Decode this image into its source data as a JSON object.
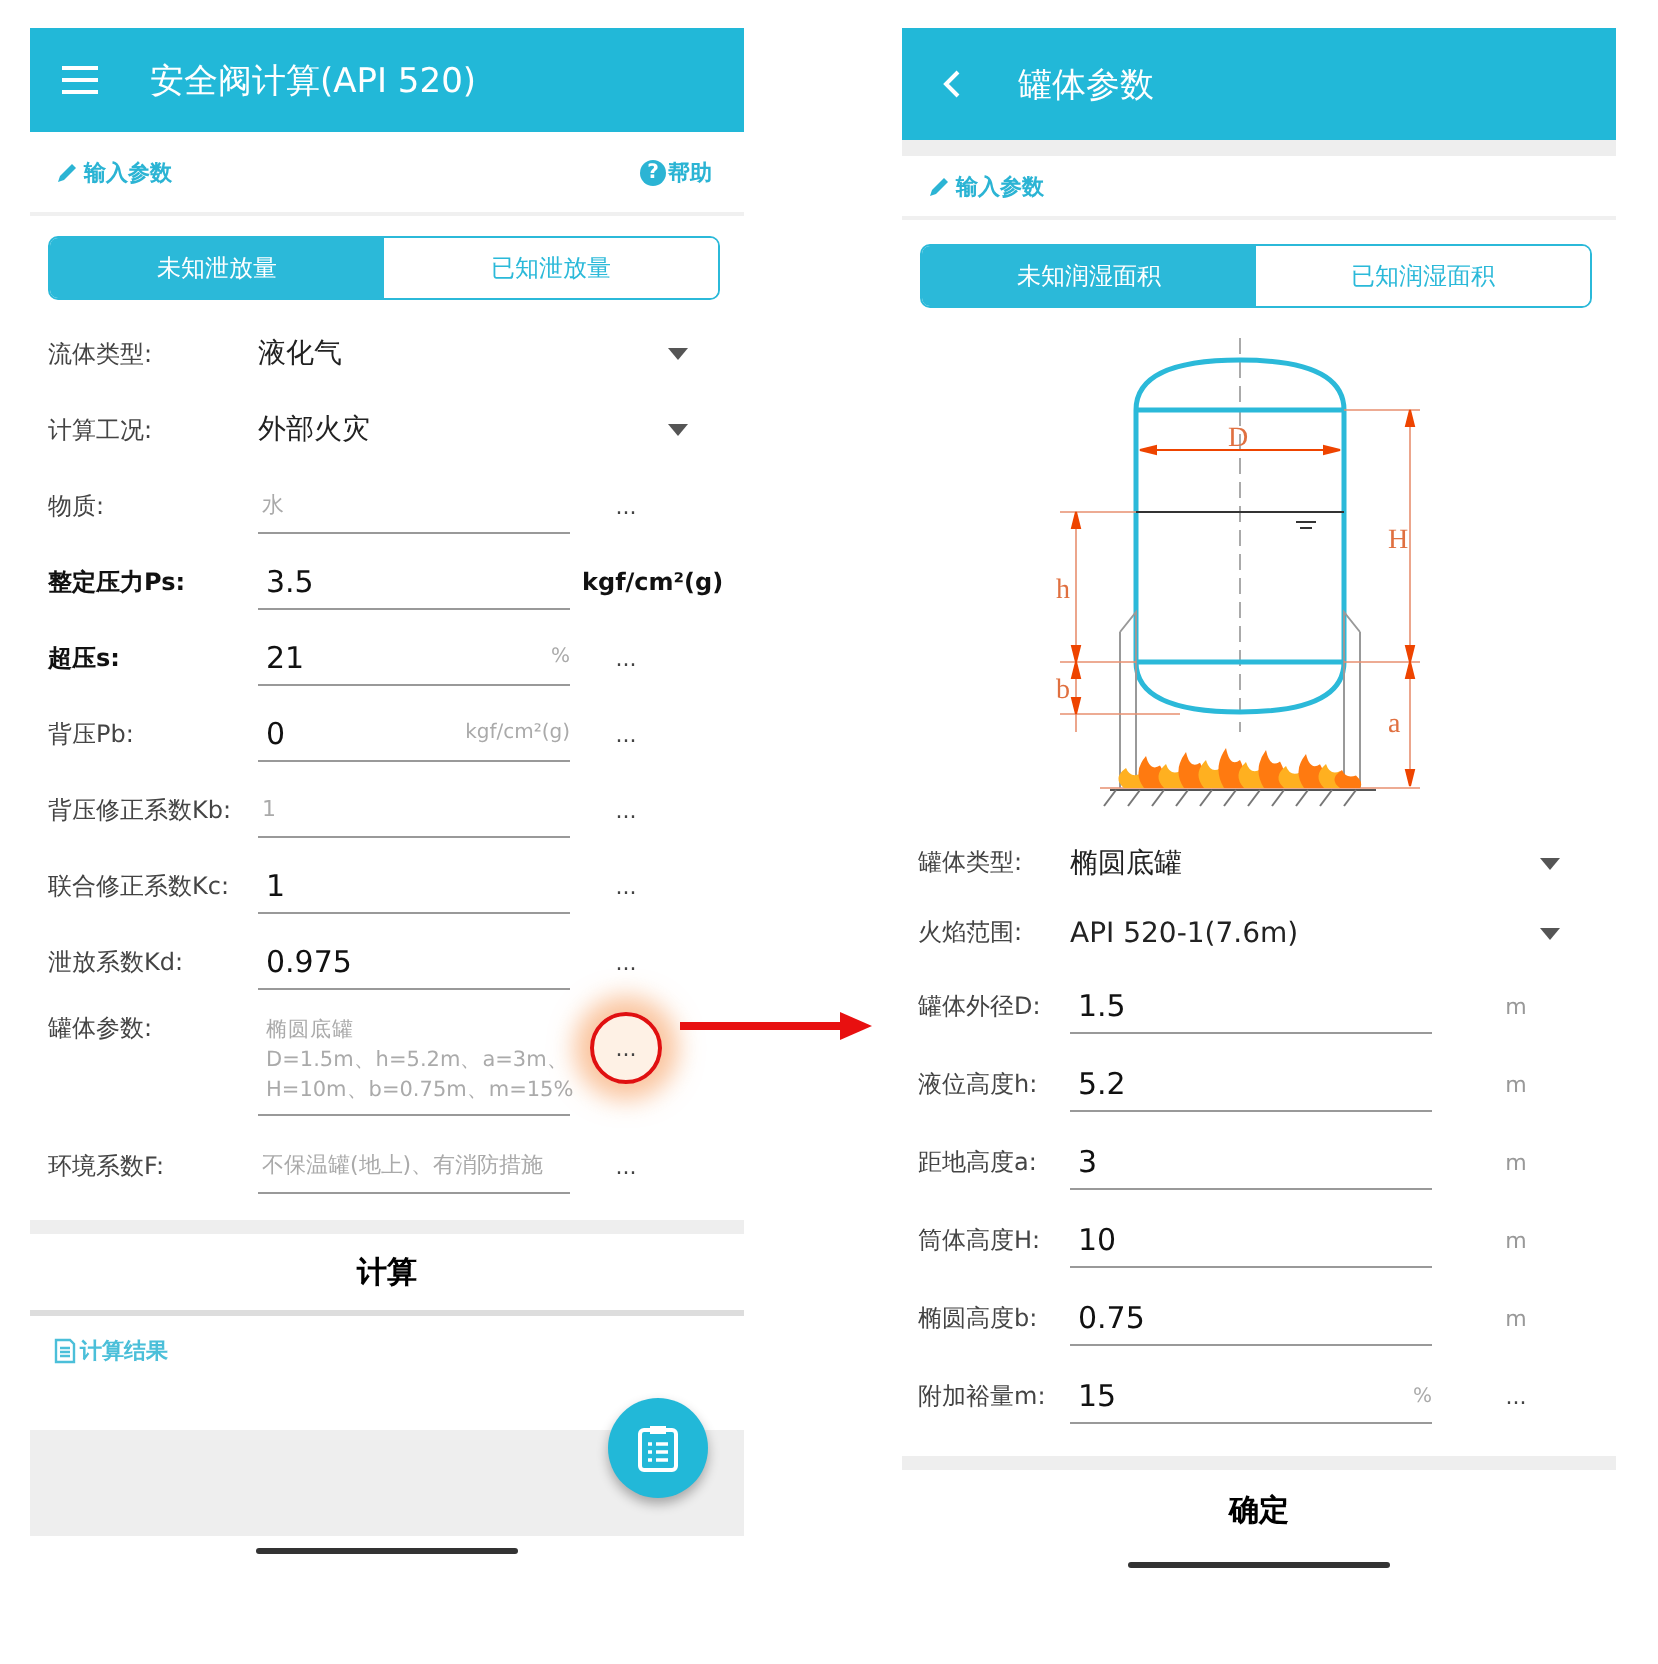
{
  "left": {
    "header": {
      "title": "安全阀计算(API 520)"
    },
    "section": {
      "title": "输入参数",
      "help_icon": "?",
      "help": "帮助"
    },
    "tabs": [
      {
        "label": "未知泄放量",
        "selected": true
      },
      {
        "label": "已知泄放量",
        "selected": false
      }
    ],
    "rows": [
      {
        "kind": "select",
        "label": "流体类型:",
        "value": "液化气",
        "emphasized": false
      },
      {
        "kind": "select",
        "label": "计算工况:",
        "value": "外部火灾",
        "emphasized": false
      },
      {
        "kind": "input",
        "label": "物质:",
        "placeholder": "水",
        "more": "...",
        "highlighted": false,
        "emphasized": false
      },
      {
        "kind": "input",
        "label": "整定压力Ps:",
        "value": "3.5",
        "unit": "kgf/cm²(g)",
        "emphasized": true
      },
      {
        "kind": "input",
        "label": "超压s:",
        "value": "21",
        "suffix": "%",
        "more": "...",
        "highlighted": false,
        "emphasized": true
      },
      {
        "kind": "input",
        "label": "背压Pb:",
        "value": "0",
        "suffix": "kgf/cm²(g)",
        "more": "...",
        "highlighted": false,
        "emphasized": false
      },
      {
        "kind": "input",
        "label": "背压修正系数Kb:",
        "placeholder": "1",
        "more": "...",
        "highlighted": false,
        "emphasized": false
      },
      {
        "kind": "input",
        "label": "联合修正系数Kc:",
        "value": "1",
        "more": "...",
        "highlighted": false,
        "emphasized": false
      },
      {
        "kind": "input",
        "label": "泄放系数Kd:",
        "value": "0.975",
        "more": "...",
        "highlighted": false,
        "emphasized": false
      },
      {
        "kind": "note",
        "label": "罐体参数:",
        "lines": [
          "椭圆底罐",
          "D=1.5m、h=5.2m、a=3m、",
          "H=10m、b=0.75m、m=15%"
        ],
        "more": "...",
        "highlighted": true,
        "emphasized": false
      },
      {
        "kind": "input",
        "label": "环境系数F:",
        "placeholder": "不保温罐(地上)、有消防措施",
        "more": "...",
        "highlighted": false,
        "emphasized": false
      }
    ],
    "action": "计算",
    "result_section": "计算结果"
  },
  "right": {
    "header": {
      "title": "罐体参数"
    },
    "section": {
      "title": "输入参数"
    },
    "tabs": [
      {
        "label": "未知润湿面积",
        "selected": true
      },
      {
        "label": "已知润湿面积",
        "selected": false
      }
    ],
    "diagram": {
      "labels": [
        "D",
        "H",
        "h",
        "b",
        "a"
      ]
    },
    "rows": [
      {
        "kind": "select",
        "label": "罐体类型:",
        "value": "椭圆底罐",
        "emphasized": false
      },
      {
        "kind": "select",
        "label": "火焰范围:",
        "value": "API 520-1(7.6m)",
        "emphasized": false
      },
      {
        "kind": "input",
        "label": "罐体外径D:",
        "value": "1.5",
        "unit": "m",
        "emphasized": false
      },
      {
        "kind": "input",
        "label": "液位高度h:",
        "value": "5.2",
        "unit": "m",
        "emphasized": false
      },
      {
        "kind": "input",
        "label": "距地高度a:",
        "value": "3",
        "unit": "m",
        "emphasized": false
      },
      {
        "kind": "input",
        "label": "筒体高度H:",
        "value": "10",
        "unit": "m",
        "emphasized": false
      },
      {
        "kind": "input",
        "label": "椭圆高度b:",
        "value": "0.75",
        "unit": "m",
        "emphasized": false
      },
      {
        "kind": "input",
        "label": "附加裕量m:",
        "value": "15",
        "suffix": "%",
        "more": "...",
        "highlighted": false,
        "emphasized": false
      }
    ],
    "action": "确定"
  }
}
